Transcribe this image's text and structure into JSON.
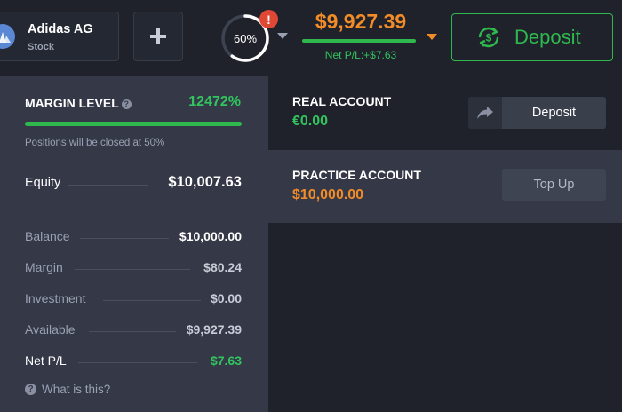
{
  "asset": {
    "name": "Adidas AG",
    "type": "Stock"
  },
  "header": {
    "risk_percent_label": "60%",
    "risk_fraction": 0.6,
    "alert_badge": "!",
    "balance": "$9,927.39",
    "net_pl": "Net P/L:+$7.63",
    "deposit_label": "Deposit"
  },
  "margin_panel": {
    "title": "MARGIN LEVEL",
    "value": "12472%",
    "note": "Positions will be closed at 50%",
    "equity_label": "Equity",
    "equity_value": "$10,007.63",
    "rows": [
      {
        "label": "Balance",
        "value": "$10,000.00"
      },
      {
        "label": "Margin",
        "value": "$80.24"
      },
      {
        "label": "Investment",
        "value": "$0.00"
      },
      {
        "label": "Available",
        "value": "$9,927.39"
      },
      {
        "label": "Net P/L",
        "value": "$7.63"
      }
    ],
    "help_link": "What is this?"
  },
  "accounts": {
    "real": {
      "name": "REAL ACCOUNT",
      "amount": "€0.00",
      "button": "Deposit"
    },
    "practice": {
      "name": "PRACTICE ACCOUNT",
      "amount": "$10,000.00",
      "button": "Top Up"
    }
  },
  "colors": {
    "accent_green": "#2fb84d",
    "accent_orange": "#f28c28",
    "alert_red": "#e04836",
    "panel_bg": "#343847",
    "app_bg": "#1f222b"
  },
  "icons": [
    "adidas-logo-icon",
    "plus-icon",
    "risk-progress-ring",
    "alert-icon",
    "chevron-down-icon",
    "deposit-cycle-icon",
    "info-icon",
    "share-arrow-icon"
  ]
}
